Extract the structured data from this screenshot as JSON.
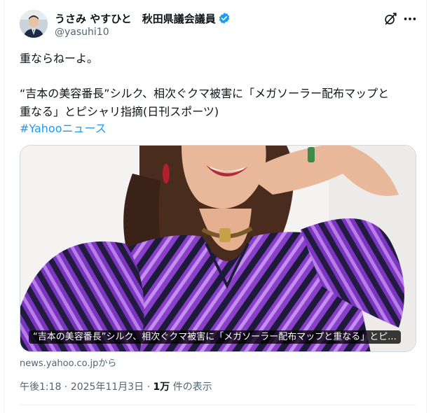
{
  "author": {
    "display_name": "うさみ やすひと　秋田県議会議員",
    "handle": "@yasuhi10",
    "verified_icon": "verified-badge-icon",
    "accent": "#1d9bf0"
  },
  "actions": {
    "grok_icon": "grok-icon",
    "more_icon": "more-options-icon"
  },
  "tweet": {
    "line1": "重ならねーよ。",
    "line2": "“吉本の美容番長”シルク、相次ぐクマ被害に「メガソーラー配布マップと",
    "line3": "重なる」とピシャリ指摘(日刊スポーツ)",
    "hashtag": "#Yahooニュース"
  },
  "link_card": {
    "title": "“吉本の美容番長”シルク、相次ぐクマ被害に「メガソーラー配布マップと重なる」とピ...",
    "domain": "news.yahoo.co.jpから"
  },
  "meta": {
    "time": "午後1:18",
    "date": "2025年11月3日",
    "sep": " · ",
    "views_count": "1万",
    "views_label": " 件の表示"
  }
}
